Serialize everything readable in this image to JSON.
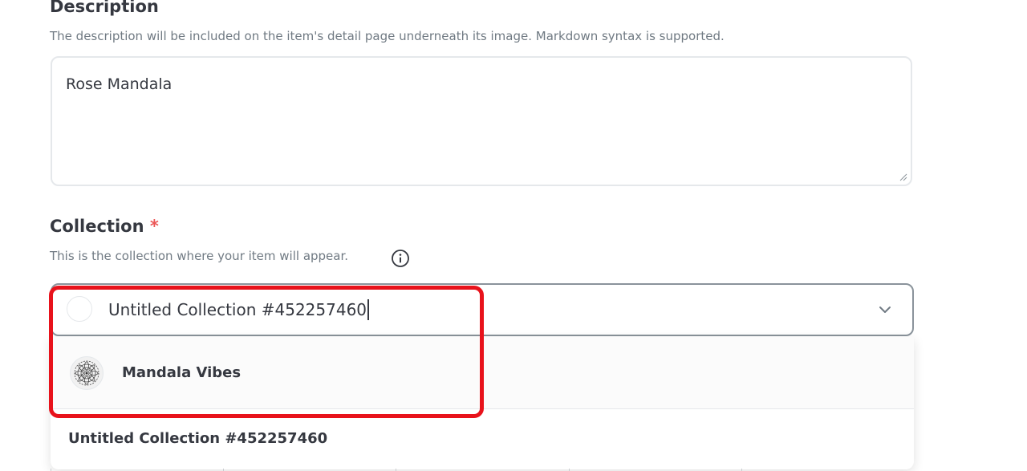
{
  "description": {
    "title": "Description",
    "help": "The description will be included on the item's detail page underneath its image. Markdown syntax is supported.",
    "value": "Rose Mandala"
  },
  "collection": {
    "title": "Collection",
    "required_mark": "*",
    "help": "This is the collection where your item will appear.",
    "info_icon": "info-icon",
    "selected_value": "Untitled Collection #452257460",
    "chevron_icon": "chevron-down-icon",
    "options": [
      {
        "label": "Mandala Vibes",
        "icon": "mandala-avatar"
      },
      {
        "label": "Untitled Collection #452257460"
      }
    ]
  },
  "colors": {
    "highlight": "#e8121b",
    "required": "#eb5757",
    "text": "#353840",
    "muted": "#707a83"
  }
}
